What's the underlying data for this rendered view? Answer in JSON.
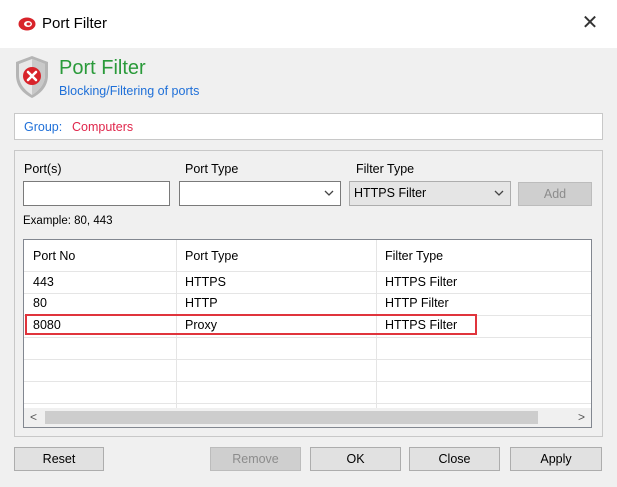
{
  "window": {
    "title": "Port Filter",
    "close_glyph": "✕"
  },
  "header": {
    "title": "Port Filter",
    "subtitle": "Blocking/Filtering of ports"
  },
  "group": {
    "label": "Group:",
    "value": "Computers"
  },
  "form": {
    "ports_label": "Port(s)",
    "ports_value": "",
    "port_type_label": "Port Type",
    "port_type_value": "",
    "filter_type_label": "Filter Type",
    "filter_type_value": "HTTPS Filter",
    "add_label": "Add",
    "example_text": "Example:  80, 443"
  },
  "table": {
    "columns": [
      "Port No",
      "Port Type",
      "Filter Type"
    ],
    "rows": [
      [
        "443",
        "HTTPS",
        "HTTPS Filter"
      ],
      [
        "80",
        "HTTP",
        "HTTP Filter"
      ],
      [
        "8080",
        "Proxy",
        "HTTPS Filter"
      ]
    ],
    "scroll_left": "<",
    "scroll_right": ">"
  },
  "buttons": {
    "reset": "Reset",
    "remove": "Remove",
    "ok": "OK",
    "close": "Close",
    "apply": "Apply"
  },
  "colors": {
    "header_title": "#2a9a3a",
    "link_blue": "#1e6fd8",
    "group_value": "#e0264b",
    "selection_outline": "#e0343c"
  },
  "icons": {
    "app": "app-logo-icon",
    "shield": "shield-error-icon",
    "dropdown": "chevron-down-icon"
  }
}
